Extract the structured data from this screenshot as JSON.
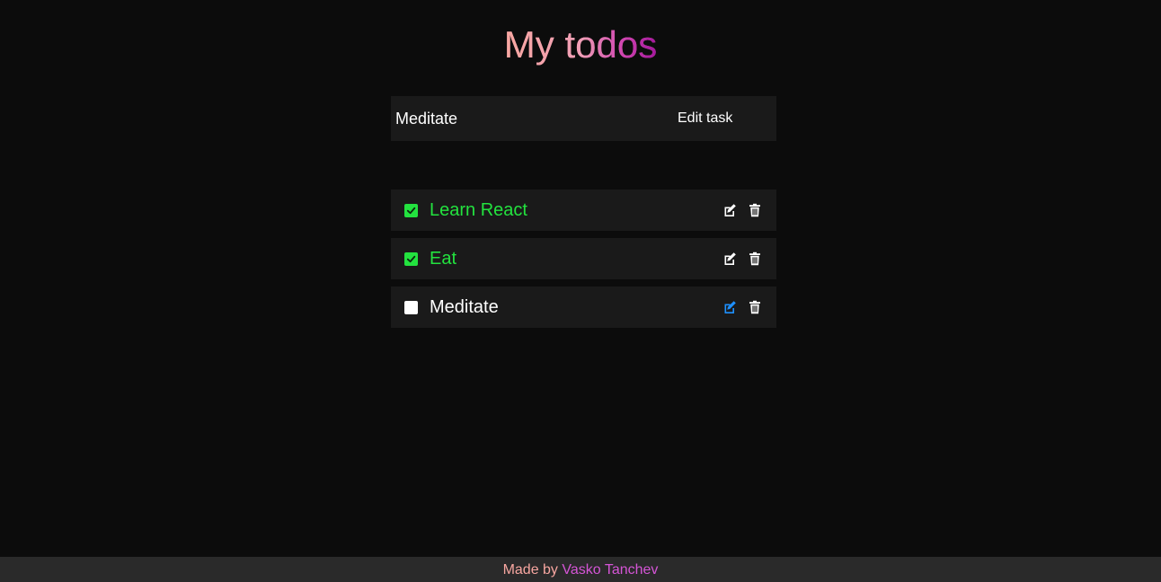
{
  "header": {
    "title": "My todos"
  },
  "edit_form": {
    "input_value": "Meditate",
    "submit_label": "Edit task"
  },
  "todos": [
    {
      "text": "Learn React",
      "completed": true,
      "edit_icon": "edit-icon",
      "delete_icon": "trash-icon"
    },
    {
      "text": "Eat",
      "completed": true,
      "edit_icon": "edit-icon",
      "delete_icon": "trash-icon"
    },
    {
      "text": "Meditate",
      "completed": false,
      "editing": true,
      "edit_icon": "edit-icon",
      "delete_icon": "trash-icon"
    }
  ],
  "footer": {
    "made_by": "Made by",
    "author": "Vasko Tanchev"
  },
  "colors": {
    "background": "#0c0c0c",
    "card": "#1a1a1a",
    "completed": "#23e23f",
    "active_edit_icon": "#1e90ff",
    "footer_bg": "#2a2a2a",
    "footer_made_by": "#f7a6a0",
    "footer_author": "#d555d6"
  }
}
